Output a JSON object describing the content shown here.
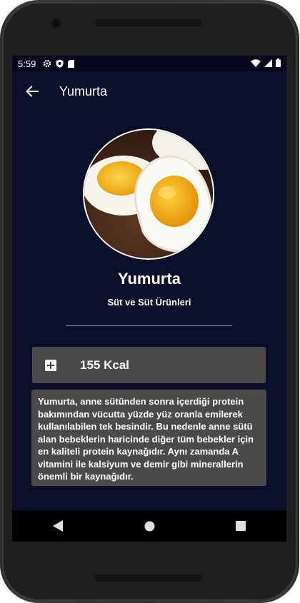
{
  "status_bar": {
    "time": "5:59",
    "left_icons": [
      "gear-icon",
      "shield-icon",
      "sd-card-icon"
    ],
    "right_icons": [
      "wifi-icon",
      "signal-icon",
      "battery-icon"
    ]
  },
  "app_bar": {
    "title": "Yumurta",
    "back_icon": "arrow-left-icon"
  },
  "food": {
    "name": "Yumurta",
    "category": "Süt ve Süt Ürünleri",
    "image": "boiled-egg-photo",
    "calories": "155 Kcal",
    "calories_icon": "plus-box-icon",
    "description": "Yumurta, anne sütünden sonra içerdiği protein bakımından vücutta yüzde yüz oranla emilerek kullanılabilen tek besindir. Bu nedenle anne sütü alan bebeklerin haricinde diğer tüm bebekler için en kaliteli protein kaynağıdır. Aynı zamanda A vitamini ile kalsiyum ve demir gibi minerallerin önemli bir kaynağıdır."
  },
  "nav_bar": [
    "back-triangle-icon",
    "home-circle-icon",
    "recents-square-icon"
  ],
  "colors": {
    "screen_bg": "#0b0f2a",
    "card_bg": "#4a4a4a",
    "text": "#ffffff"
  }
}
